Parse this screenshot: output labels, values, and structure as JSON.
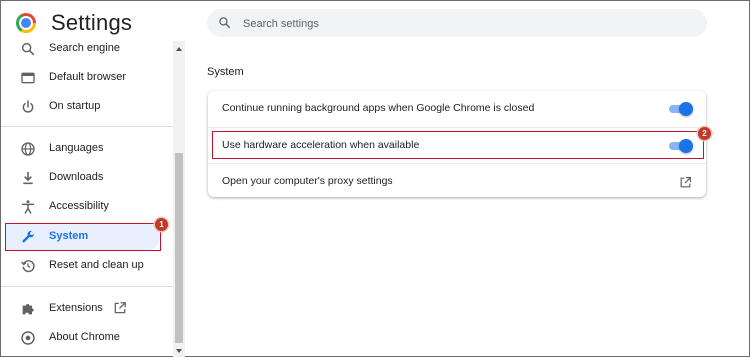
{
  "header": {
    "title": "Settings"
  },
  "search": {
    "placeholder": "Search settings",
    "value": ""
  },
  "sidebar": {
    "items": [
      {
        "label": "Search engine",
        "icon": "search-icon"
      },
      {
        "label": "Default browser",
        "icon": "browser-icon"
      },
      {
        "label": "On startup",
        "icon": "power-icon"
      },
      {
        "label": "Languages",
        "icon": "globe-icon"
      },
      {
        "label": "Downloads",
        "icon": "download-icon"
      },
      {
        "label": "Accessibility",
        "icon": "accessibility-icon"
      },
      {
        "label": "System",
        "icon": "wrench-icon",
        "active": true
      },
      {
        "label": "Reset and clean up",
        "icon": "restore-icon"
      },
      {
        "label": "Extensions",
        "icon": "puzzle-icon"
      },
      {
        "label": "About Chrome",
        "icon": "chrome-icon"
      }
    ]
  },
  "main": {
    "section_title": "System",
    "rows": [
      {
        "label": "Continue running background apps when Google Chrome is closed",
        "control": "toggle",
        "on": true
      },
      {
        "label": "Use hardware acceleration when available",
        "control": "toggle",
        "on": true
      },
      {
        "label": "Open your computer's proxy settings",
        "control": "open-in-new-icon"
      }
    ]
  },
  "annotations": [
    {
      "number": "1"
    },
    {
      "number": "2"
    }
  ],
  "colors": {
    "accent": "#1a73e8",
    "active_bg": "#e8f0fe",
    "highlight": "#c8102e"
  }
}
